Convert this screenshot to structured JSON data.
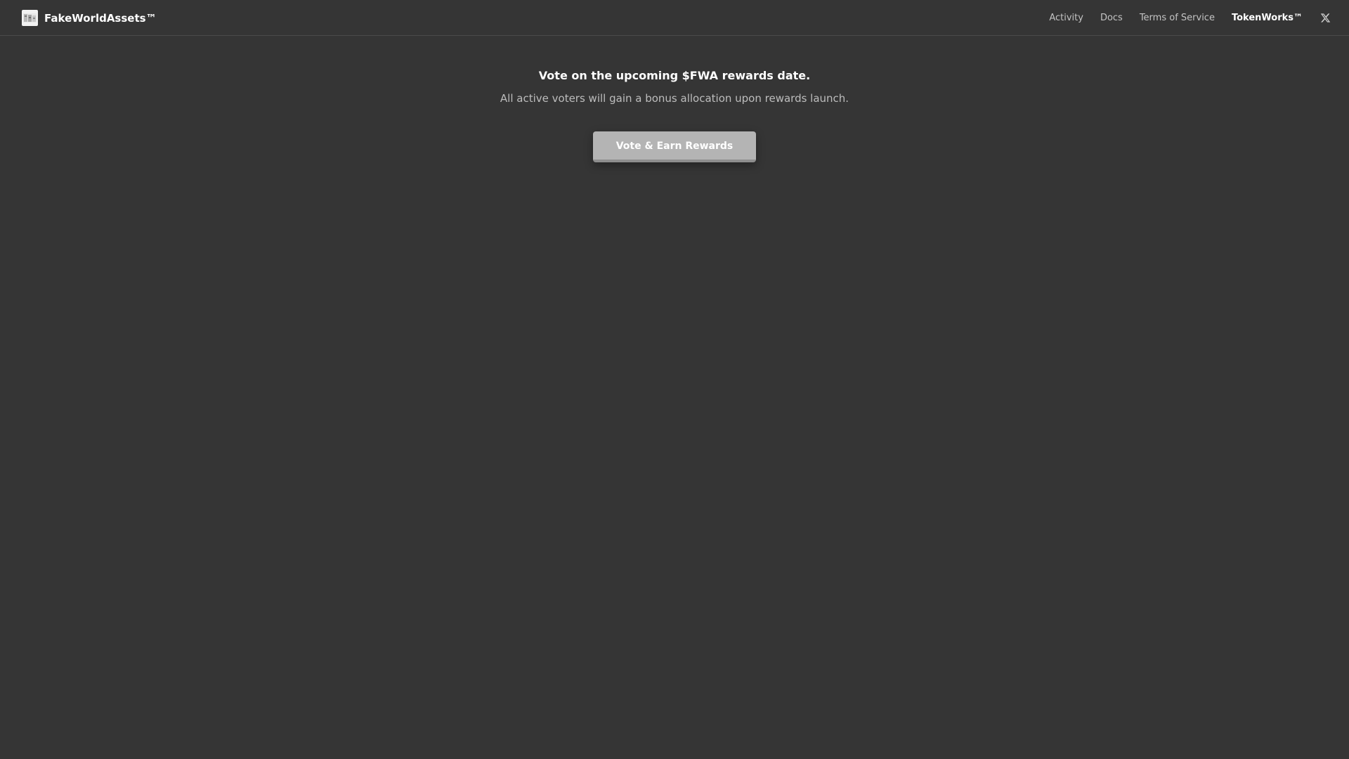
{
  "navbar": {
    "brand": {
      "logo_icon": "fake-world-assets-logo",
      "name": "FakeWorldAssets™"
    },
    "links": [
      {
        "label": "Activity"
      },
      {
        "label": "Docs"
      },
      {
        "label": "Terms of Service"
      },
      {
        "label": "TokenWorks™"
      }
    ],
    "social_icon": "x-icon"
  },
  "hero": {
    "title": "Vote on the upcoming $FWA rewards date.",
    "subtitle": "All active voters will gain a bonus allocation upon rewards launch.",
    "cta_label": "Vote & Earn Rewards"
  },
  "colors": {
    "background": "#353535",
    "cta_background": "#b4b4b4",
    "text_primary": "#ffffff",
    "text_secondary": "#bdbdbd"
  }
}
